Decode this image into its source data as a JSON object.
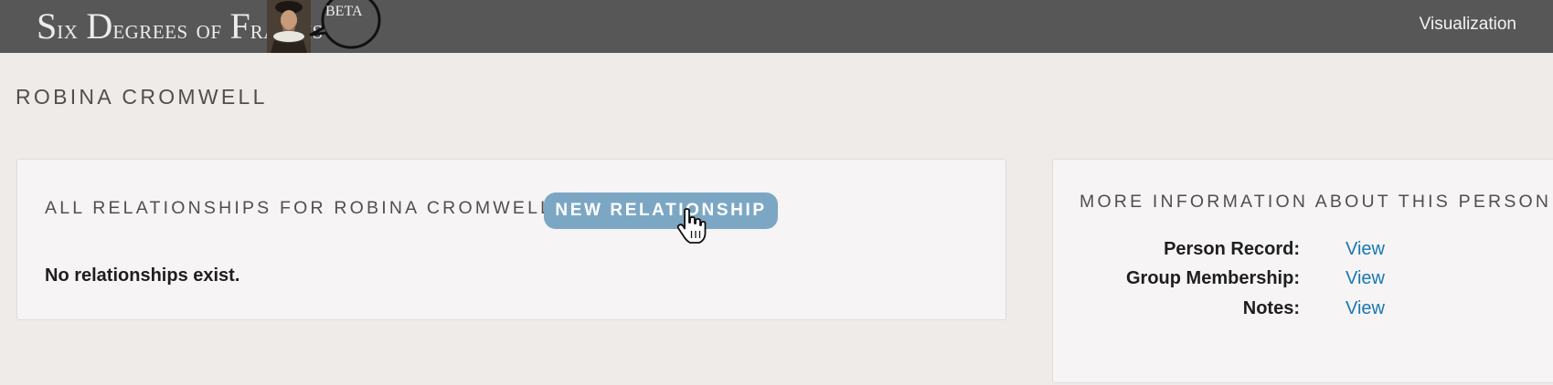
{
  "header": {
    "brand": {
      "six_initial": "S",
      "six_rest": "IX",
      "degrees_initial": "D",
      "degrees_rest": "EGREES",
      "of": "OF",
      "francis_initial": "F",
      "francis_rest": "RANCIS",
      "beta_initial": "B",
      "beta_rest": "ETA"
    },
    "nav": {
      "visualization": "Visualization"
    }
  },
  "page": {
    "title": "ROBINA CROMWELL"
  },
  "relationships_panel": {
    "heading": "ALL RELATIONSHIPS FOR ROBINA CROMWELL",
    "new_button": "NEW RELATIONSHIP",
    "empty_message": "No relationships exist."
  },
  "info_panel": {
    "heading": "MORE INFORMATION ABOUT THIS PERSON",
    "rows": [
      {
        "label": "Person Record:",
        "link": "View"
      },
      {
        "label": "Group Membership:",
        "link": "View"
      },
      {
        "label": "Notes:",
        "link": "View"
      }
    ]
  },
  "colors": {
    "topbar": "#575757",
    "background": "#eeebe8",
    "button": "#7ca7c4",
    "link": "#1a77b3"
  }
}
